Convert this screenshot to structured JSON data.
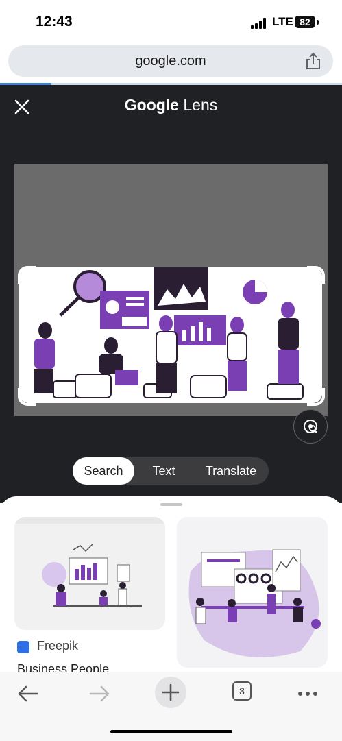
{
  "status": {
    "time": "12:43",
    "network": "LTE",
    "battery": "82"
  },
  "browser": {
    "url": "google.com",
    "load_progress": 0.15
  },
  "lens": {
    "title_bold": "Google",
    "title_rest": " Lens",
    "modes": [
      {
        "label": "Search",
        "active": true
      },
      {
        "label": "Text",
        "active": false
      },
      {
        "label": "Translate",
        "active": false
      }
    ],
    "accent_color": "#7b3fb4"
  },
  "results": [
    {
      "source": "Freepik",
      "title": "Business People"
    },
    {
      "source": "",
      "title": ""
    }
  ],
  "toolbar": {
    "tab_count": "3"
  },
  "icons": {
    "close": "close-icon",
    "share": "share-icon",
    "lens_camera": "lens-camera-icon",
    "back": "back-arrow-icon",
    "forward": "forward-arrow-icon",
    "new_tab": "plus-icon",
    "tabs": "tabs-icon",
    "more": "more-dots-icon"
  }
}
